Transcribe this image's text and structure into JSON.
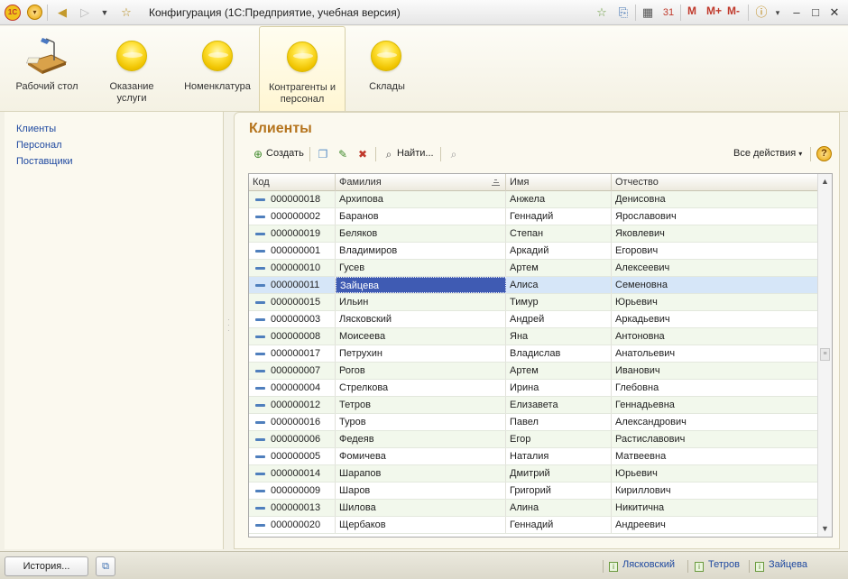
{
  "window": {
    "title": "Конфигурация  (1С:Предприятие, учебная версия)",
    "logo_text": "1С",
    "memory_buttons": [
      "M",
      "M+",
      "M-"
    ]
  },
  "sections": [
    {
      "label": "Рабочий стол",
      "icon": "desktop-icon"
    },
    {
      "label": "Оказание услуги",
      "icon": "section-orb-icon"
    },
    {
      "label": "Номенклатура",
      "icon": "section-orb-icon"
    },
    {
      "label": "Контрагенты и персонал",
      "icon": "section-orb-icon",
      "active": true
    },
    {
      "label": "Склады",
      "icon": "section-orb-icon"
    }
  ],
  "leftnav": {
    "items": [
      "Клиенты",
      "Персонал",
      "Поставщики"
    ]
  },
  "form": {
    "title": "Клиенты",
    "toolbar": {
      "create": "Создать",
      "find": "Найти...",
      "all_actions": "Все действия",
      "help": "?"
    },
    "columns": [
      "Код",
      "Фамилия",
      "Имя",
      "Отчество"
    ],
    "rows": [
      [
        "000000018",
        "Архипова",
        "Анжела",
        "Денисовна"
      ],
      [
        "000000002",
        "Баранов",
        "Геннадий",
        "Ярославович"
      ],
      [
        "000000019",
        "Беляков",
        "Степан",
        "Яковлевич"
      ],
      [
        "000000001",
        "Владимиров",
        "Аркадий",
        "Егорович"
      ],
      [
        "000000010",
        "Гусев",
        "Артем",
        "Алексеевич"
      ],
      [
        "000000011",
        "Зайцева",
        "Алиса",
        "Семеновна"
      ],
      [
        "000000015",
        "Ильин",
        "Тимур",
        "Юрьевич"
      ],
      [
        "000000003",
        "Лясковский",
        "Андрей",
        "Аркадьевич"
      ],
      [
        "000000008",
        "Моисеева",
        "Яна",
        "Антоновна"
      ],
      [
        "000000017",
        "Петрухин",
        "Владислав",
        "Анатольевич"
      ],
      [
        "000000007",
        "Рогов",
        "Артем",
        "Иванович"
      ],
      [
        "000000004",
        "Стрелкова",
        "Ирина",
        "Глебовна"
      ],
      [
        "000000012",
        "Тетров",
        "Елизавета",
        "Геннадьевна"
      ],
      [
        "000000016",
        "Туров",
        "Павел",
        "Александрович"
      ],
      [
        "000000006",
        "Федеяв",
        "Егор",
        "Растиславович"
      ],
      [
        "000000005",
        "Фомичева",
        "Наталия",
        "Матвеевна"
      ],
      [
        "000000014",
        "Шарапов",
        "Дмитрий",
        "Юрьевич"
      ],
      [
        "000000009",
        "Шаров",
        "Григорий",
        "Кириллович"
      ],
      [
        "000000013",
        "Шилова",
        "Алина",
        "Никитична"
      ],
      [
        "000000020",
        "Щербаков",
        "Геннадий",
        "Андреевич"
      ]
    ],
    "selected_row": 5
  },
  "bottombar": {
    "history": "История...",
    "open_windows": [
      "Лясковский",
      "Тетров",
      "Зайцева"
    ]
  },
  "colors": {
    "title_accent": "#b5741d",
    "link": "#1f49a0",
    "selection": "#d6e6f8",
    "focus_cell": "#3f5bb3"
  }
}
